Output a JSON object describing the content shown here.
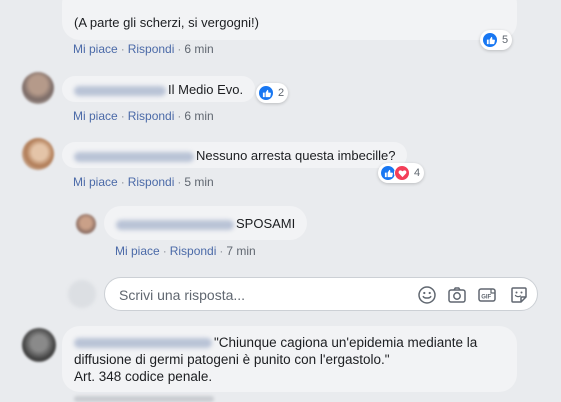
{
  "comments": [
    {
      "lines": [
        "(A parte gli scherzi, si vergogni!)"
      ],
      "like_label": "Mi piace",
      "reply_label": "Rispondi",
      "time": "6 min",
      "reaction_count": "5"
    },
    {
      "text": "Il Medio Evo.",
      "like_label": "Mi piace",
      "reply_label": "Rispondi",
      "time": "6 min",
      "reaction_count": "2"
    },
    {
      "text": "Nessuno arresta questa imbecille?",
      "like_label": "Mi piace",
      "reply_label": "Rispondi",
      "time": "5 min",
      "reaction_count": "4"
    },
    {
      "text": "SPOSAMI",
      "like_label": "Mi piace",
      "reply_label": "Rispondi",
      "time": "7 min"
    },
    {
      "lines": [
        "\"Chiunque cagiona un'epidemia mediante la",
        "diffusione di germi patogeni è punito con l'ergastolo.\"",
        "Art. 348 codice penale."
      ]
    }
  ],
  "reply_input": {
    "placeholder": "Scrivi una risposta..."
  },
  "tools": [
    "emoji-icon",
    "camera-icon",
    "gif-icon",
    "sticker-icon"
  ],
  "colors": {
    "link": "#4b6aa8",
    "like": "#1877f2",
    "love": "#f33e58",
    "bubble": "#f2f3f5",
    "background": "#e9ebee"
  }
}
